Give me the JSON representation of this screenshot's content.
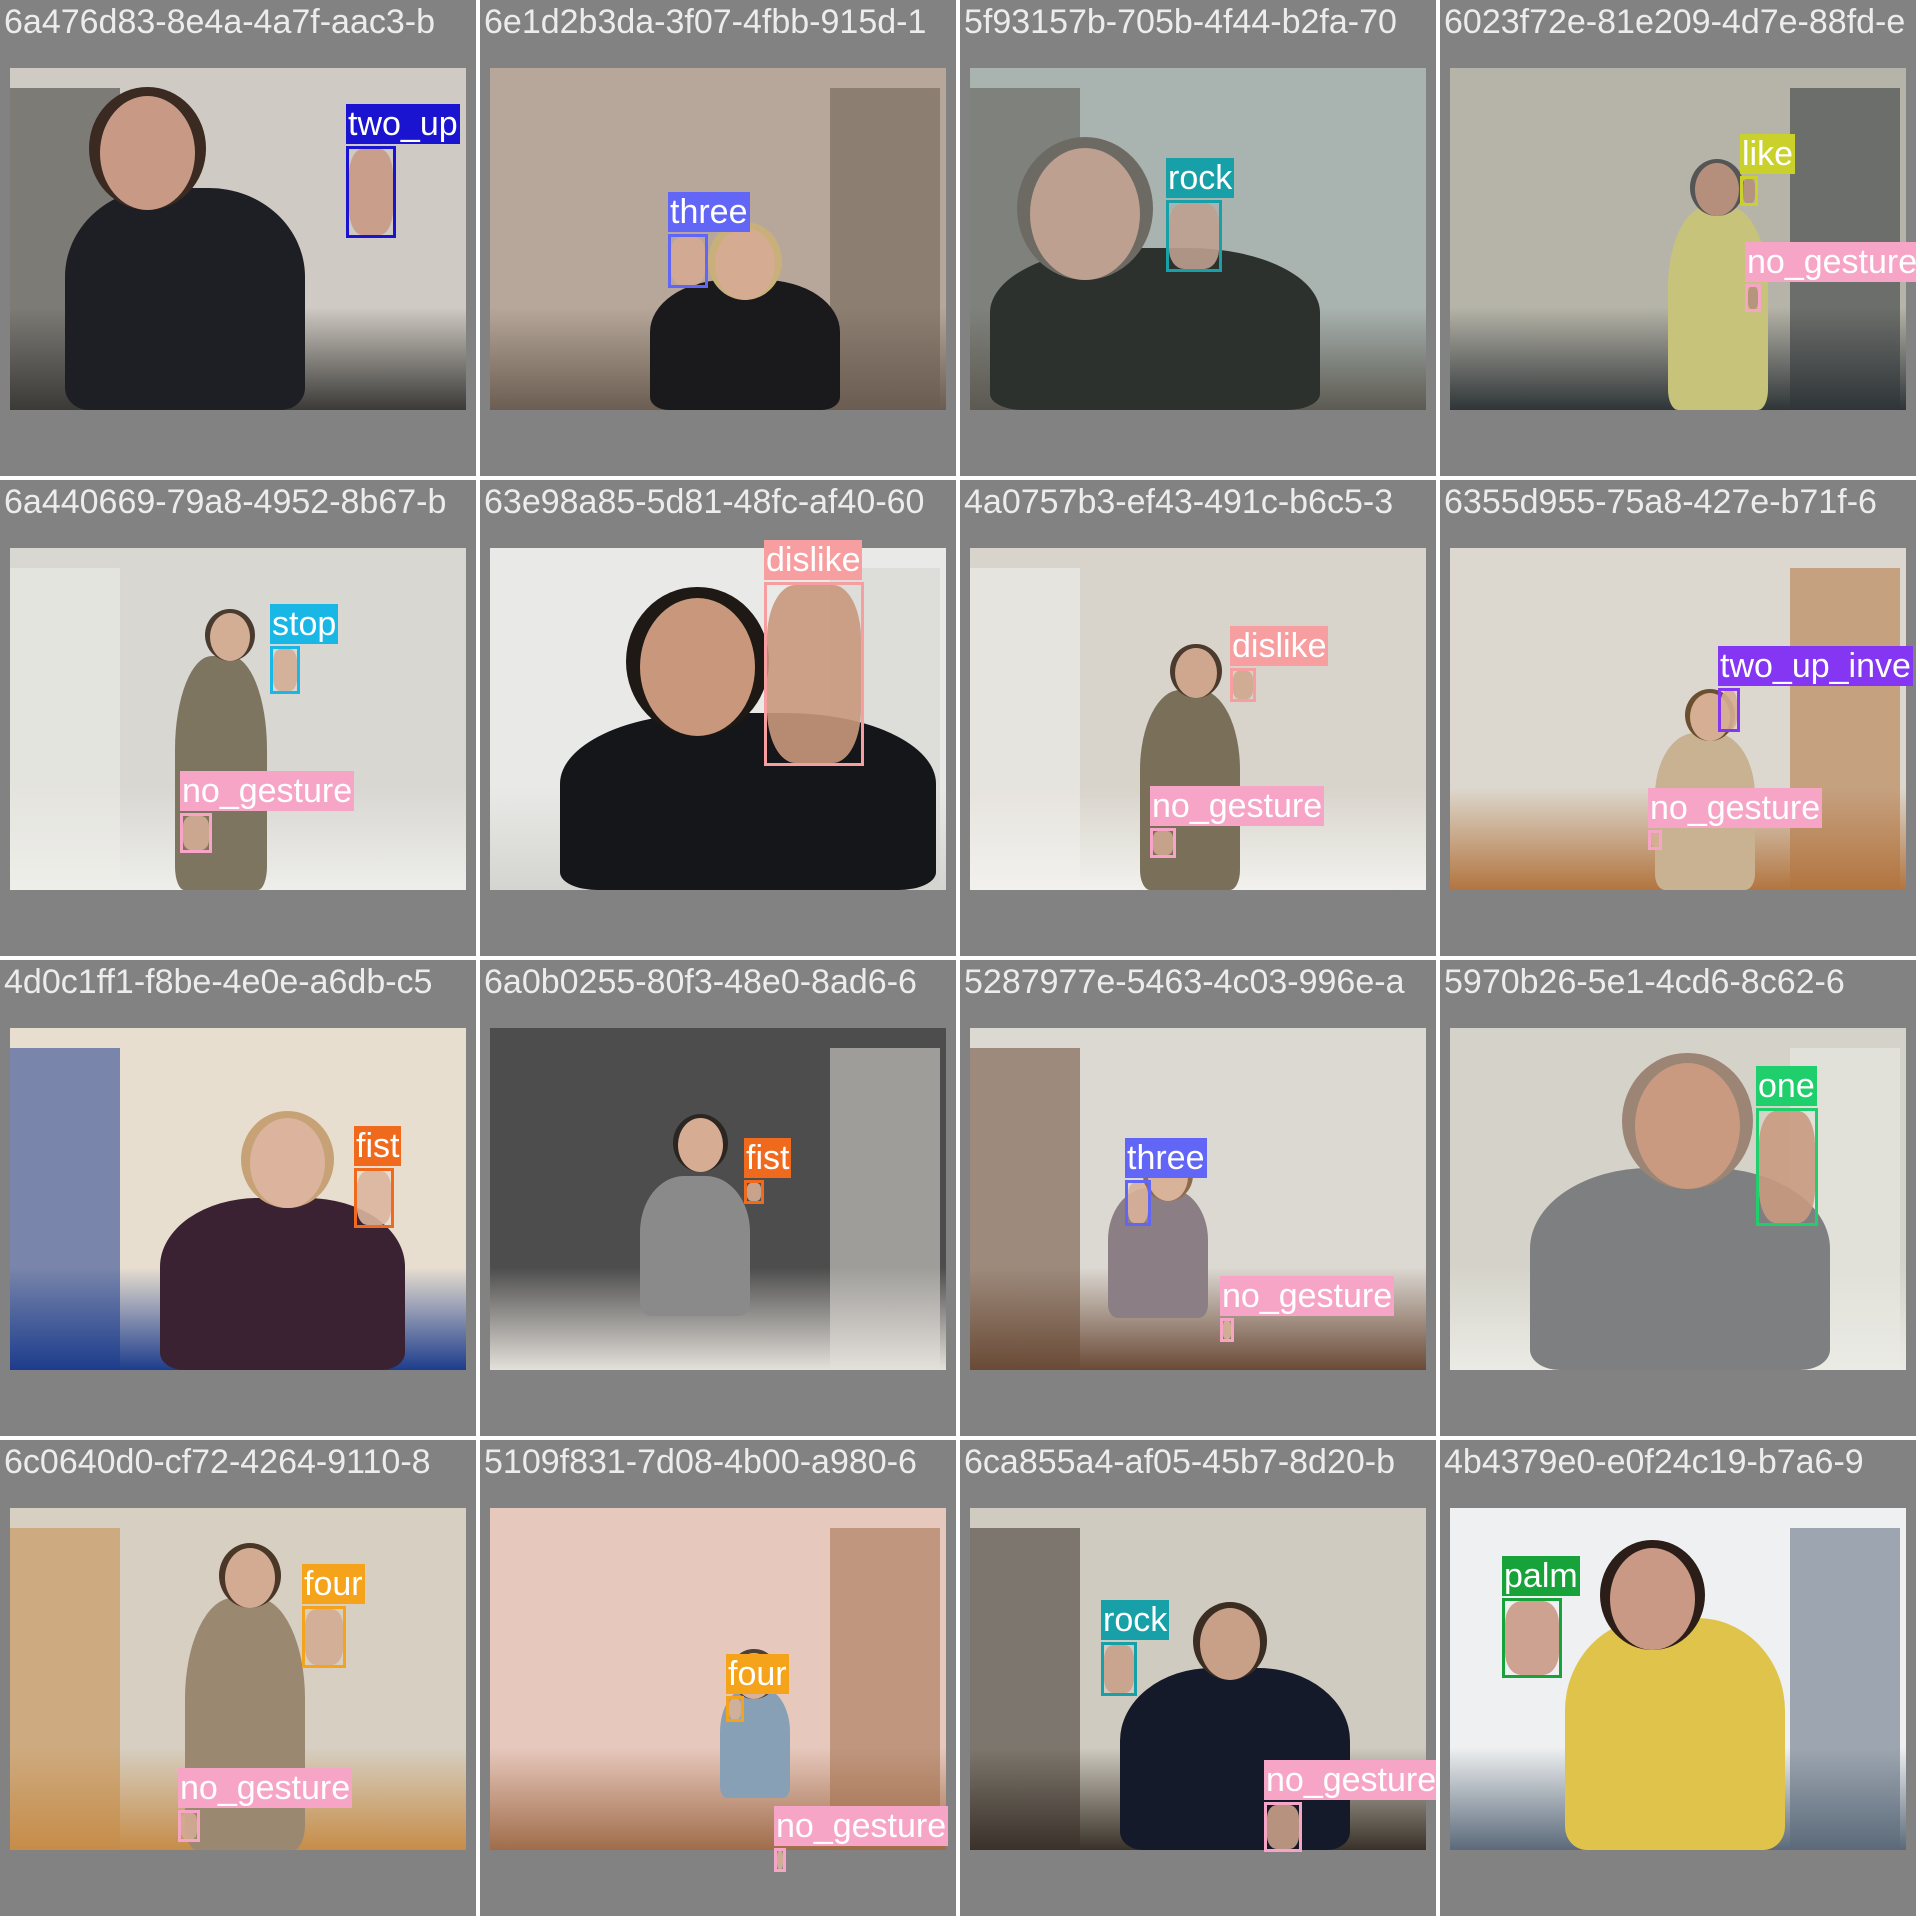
{
  "grid_title": "",
  "cells": [
    {
      "filename": "6a476d83-8e4a-4a7f-aac3-b",
      "scene": {
        "bg": "#cfcac3",
        "wall2": "#3b3a37",
        "person_top": "#1d1f24",
        "skin": "#c89a86",
        "hair": "#3a2a22"
      },
      "detections": [
        {
          "label": "two_up",
          "color": "#1a14d0"
        }
      ]
    },
    {
      "filename": "6e1d2b3da-3f07-4fbb-915d-1",
      "scene": {
        "bg": "#b6a79a",
        "wall2": "#6c5d52",
        "person_top": "#1a1a1d",
        "skin": "#d5ab92",
        "hair": "#c9b07a"
      },
      "detections": [
        {
          "label": "three",
          "color": "#6166f6"
        }
      ]
    },
    {
      "filename": "5f93157b-705b-4f44-b2fa-70",
      "scene": {
        "bg": "#a9b3b0",
        "wall2": "#5c5a52",
        "person_top": "#2c312d",
        "skin": "#bda08f",
        "hair": "#6d6a64"
      },
      "detections": [
        {
          "label": "rock",
          "color": "#18a0a8"
        }
      ]
    },
    {
      "filename": "6023f72e-81e209-4d7e-88fd-e",
      "scene": {
        "bg": "#b6b4a8",
        "wall2": "#2f3538",
        "person_top": "#c8c37a",
        "skin": "#b58f7c",
        "hair": "#555"
      },
      "detections": [
        {
          "label": "like",
          "color": "#c9d12a"
        },
        {
          "label": "no_gesture",
          "color": "#f7a5c6"
        }
      ]
    },
    {
      "filename": "6a440669-79a8-4952-8b67-b",
      "scene": {
        "bg": "#d8d7d2",
        "wall2": "#eeeeea",
        "person_top": "#7d7560",
        "skin": "#d3ad94",
        "hair": "#4a3b30"
      },
      "detections": [
        {
          "label": "stop",
          "color": "#18b7e6"
        },
        {
          "label": "no_gesture",
          "color": "#f7a5c6"
        }
      ]
    },
    {
      "filename": "63e98a85-5d81-48fc-af40-60",
      "scene": {
        "bg": "#e9e9e7",
        "wall2": "#d4d4d0",
        "person_top": "#14161a",
        "skin": "#c9977c",
        "hair": "#1e1914"
      },
      "detections": [
        {
          "label": "dislike",
          "color": "#f79ea0"
        }
      ]
    },
    {
      "filename": "4a0757b3-ef43-491c-b6c5-3",
      "scene": {
        "bg": "#d8d4cc",
        "wall2": "#f2f1ed",
        "person_top": "#7a705a",
        "skin": "#cfa78f",
        "hair": "#4b3b2e"
      },
      "detections": [
        {
          "label": "dislike",
          "color": "#f79ea0"
        },
        {
          "label": "no_gesture",
          "color": "#f7a5c6"
        }
      ]
    },
    {
      "filename": "6355d955-75a8-427e-b71f-6",
      "scene": {
        "bg": "#ddd8cf",
        "wall2": "#b2753f",
        "person_top": "#c8b291",
        "skin": "#d6ae93",
        "hair": "#6a5030"
      },
      "detections": [
        {
          "label": "two_up_inve",
          "color": "#8436f2"
        },
        {
          "label": "no_gesture",
          "color": "#f7a5c6"
        }
      ]
    },
    {
      "filename": "4d0c1ff1-f8be-4e0e-a6db-c5",
      "scene": {
        "bg": "#e8ded0",
        "wall2": "#1d3d8c",
        "person_top": "#3b2233",
        "skin": "#dcb49d",
        "hair": "#c7a277"
      },
      "detections": [
        {
          "label": "fist",
          "color": "#f06a1e"
        }
      ]
    },
    {
      "filename": "6a0b0255-80f3-48e0-8ad6-6",
      "scene": {
        "bg": "#4d4d4d",
        "wall2": "#e4e0da",
        "person_top": "#8a8a8a",
        "skin": "#d6ad93",
        "hair": "#2c2622"
      },
      "detections": [
        {
          "label": "fist",
          "color": "#f06a1e"
        }
      ]
    },
    {
      "filename": "5287977e-5463-4c03-996e-a",
      "scene": {
        "bg": "#dcd8d2",
        "wall2": "#6a4a36",
        "person_top": "#8b7f85",
        "skin": "#d8b39a",
        "hair": "#8d6a48"
      },
      "detections": [
        {
          "label": "three",
          "color": "#6166f6"
        },
        {
          "label": "no_gesture",
          "color": "#f7a5c6"
        }
      ]
    },
    {
      "filename": "5970b26-5e1-4cd6-8c62-6",
      "scene": {
        "bg": "#d5d3c9",
        "wall2": "#ebebe6",
        "person_top": "#7e7f80",
        "skin": "#c99a80",
        "hair": "#9c8574"
      },
      "detections": [
        {
          "label": "one",
          "color": "#1fcf6b"
        }
      ]
    },
    {
      "filename": "6c0640d0-cf72-4264-9110-8",
      "scene": {
        "bg": "#d6cfc2",
        "wall2": "#c68d49",
        "person_top": "#9a8870",
        "skin": "#d3ab92",
        "hair": "#4a3728"
      },
      "detections": [
        {
          "label": "four",
          "color": "#f5a31b"
        },
        {
          "label": "no_gesture",
          "color": "#f7a5c6"
        }
      ]
    },
    {
      "filename": "5109f831-7d08-4b00-a980-6",
      "scene": {
        "bg": "#e7c8bd",
        "wall2": "#a06d4a",
        "person_top": "#88a0b6",
        "skin": "#d7b19a",
        "hair": "#4c3f36"
      },
      "detections": [
        {
          "label": "four",
          "color": "#f5a31b"
        },
        {
          "label": "no_gesture",
          "color": "#f7a5c6"
        }
      ]
    },
    {
      "filename": "6ca855a4-af05-45b7-8d20-b",
      "scene": {
        "bg": "#cfcbc0",
        "wall2": "#3a322a",
        "person_top": "#141a2a",
        "skin": "#c8a088",
        "hair": "#3b2d22"
      },
      "detections": [
        {
          "label": "rock",
          "color": "#18a0a8"
        },
        {
          "label": "no_gesture",
          "color": "#f7a5c6"
        }
      ]
    },
    {
      "filename": "4b4379e0-e0f24c19-b7a6-9",
      "scene": {
        "bg": "#eef0f1",
        "wall2": "#5b6a7a",
        "person_top": "#e0c34a",
        "skin": "#c99985",
        "hair": "#2b1d17"
      },
      "detections": [
        {
          "label": "palm",
          "color": "#17a33a"
        }
      ]
    }
  ]
}
